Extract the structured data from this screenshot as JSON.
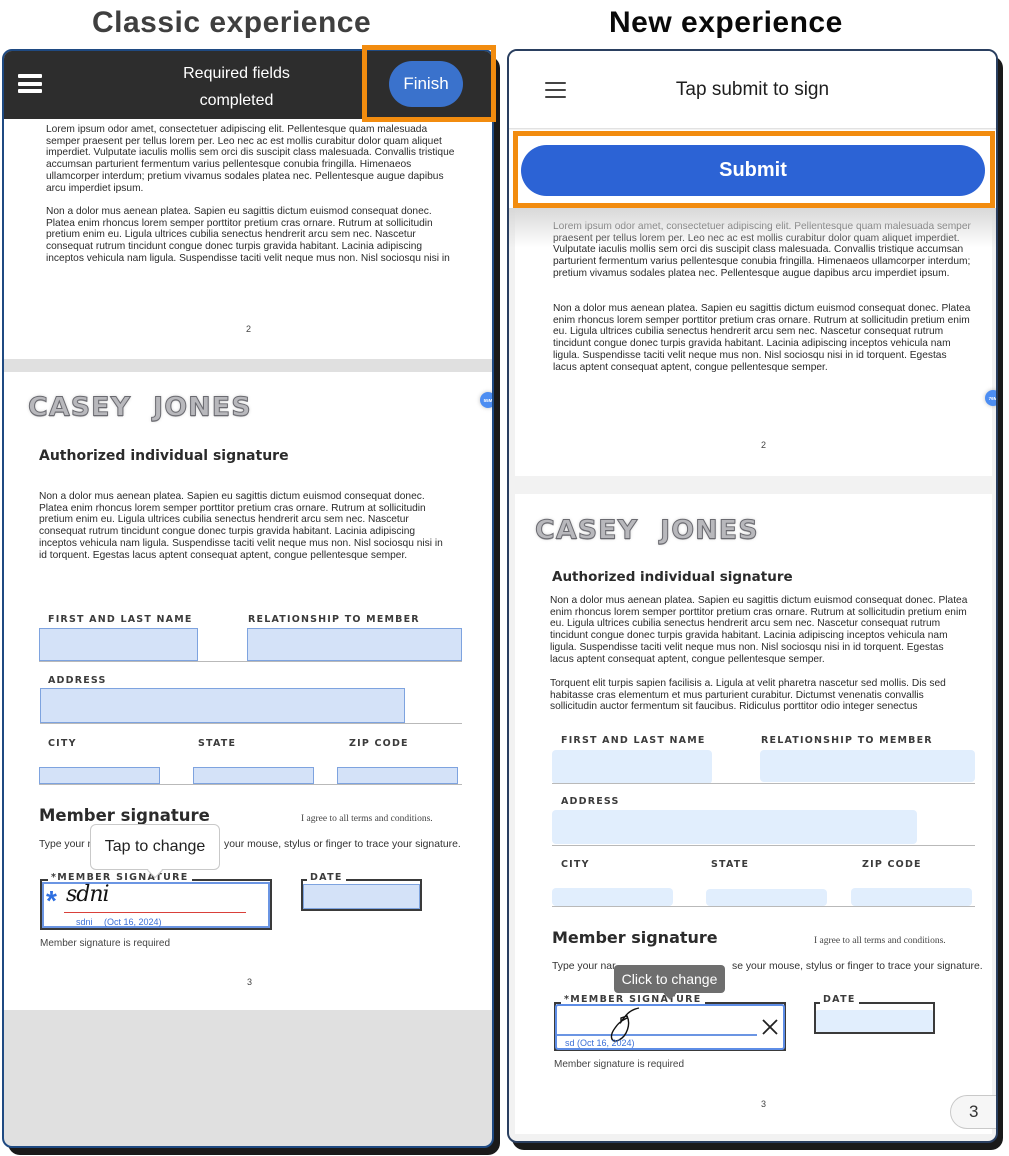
{
  "captions": {
    "classic": "Classic experience",
    "new": "New experience"
  },
  "colors": {
    "highlight_box": "#f28c0f",
    "classic_finish_button": "#3a72cc",
    "new_submit_button": "#2c63d5",
    "field_fill": "#d4e2f8"
  },
  "classic": {
    "header": {
      "menu_icon": "hamburger-menu-icon",
      "title_line1": "Required fields",
      "title_line2": "completed",
      "finish_label": "Finish"
    },
    "page2": {
      "para1": "Lorem ipsum odor amet, consectetuer adipiscing elit. Pellentesque quam malesuada semper praesent per tellus lorem per. Leo nec ac est mollis curabitur dolor quam aliquet imperdiet. Vulputate iaculis mollis sem orci dis suscipit class malesuada. Convallis tristique accumsan parturient fermentum varius pellentesque conubia fringilla. Himenaeos ullamcorper interdum; pretium vivamus sodales platea nec. Pellentesque augue dapibus arcu imperdiet ipsum.",
      "para2": "Non a dolor mus aenean platea. Sapien eu sagittis dictum euismod consequat donec. Platea enim rhoncus lorem semper porttitor pretium cras ornare. Rutrum at sollicitudin pretium enim eu. Ligula ultrices cubilia senectus hendrerit arcu sem nec. Nascetur consequat rutrum tincidunt congue donec turpis gravida habitant. Lacinia adipiscing inceptos vehicula nam ligula. Suspendisse taciti velit neque mus non. Nisl sociosqu nisi in",
      "page_number": "2"
    },
    "page3": {
      "logo_first": "CASEY",
      "logo_last": "JONES",
      "badge": "55M",
      "section_title": "Authorized individual signature",
      "para": "Non a dolor mus aenean platea. Sapien eu sagittis dictum euismod consequat donec. Platea enim rhoncus lorem semper porttitor pretium cras ornare. Rutrum at sollicitudin pretium enim eu. Ligula ultrices cubilia senectus hendrerit arcu sem nec. Nascetur consequat rutrum tincidunt congue donec turpis gravida habitant. Lacinia adipiscing inceptos vehicula nam ligula. Suspendisse taciti velit neque mus non. Nisl sociosqu nisi in id torquent. Egestas lacus aptent consequat aptent, congue pellentesque semper.",
      "labels": {
        "name": "FIRST AND LAST NAME",
        "relationship": "RELATIONSHIP TO MEMBER",
        "address": "ADDRESS",
        "city": "CITY",
        "state": "STATE",
        "zip": "ZIP CODE"
      },
      "values": {
        "name": "",
        "relationship": "",
        "address": "",
        "city": "",
        "state": "",
        "zip": "",
        "date": ""
      },
      "member_signature_title": "Member signature",
      "agree_text": "I agree to all terms and conditions.",
      "help_text": "Type your name, or use your mouse, stylus or finger to trace your signature.",
      "help_text_visible_left": "Type your n",
      "help_text_visible_right": "your mouse, stylus or finger to trace your signature.",
      "tooltip": "Tap to change",
      "signature_label": "*MEMBER SIGNATURE",
      "signature_value": "sdni",
      "signature_caption_name": "sdni",
      "signature_caption_date": "(Oct 16, 2024)",
      "required_marker": "*",
      "date_label": "DATE",
      "required_text": "Member signature is required",
      "page_number": "3"
    }
  },
  "new": {
    "header": {
      "menu_icon": "hamburger-menu-icon",
      "title": "Tap submit to sign",
      "submit_label": "Submit"
    },
    "page2": {
      "para1": "Lorem ipsum odor amet, consectetuer adipiscing elit. Pellentesque quam malesuada semper praesent per tellus lorem per. Leo nec ac est mollis curabitur dolor quam aliquet imperdiet. Vulputate iaculis mollis sem orci dis suscipit class malesuada. Convallis tristique accumsan parturient fermentum varius pellentesque conubia fringilla. Himenaeos ullamcorper interdum; pretium vivamus sodales platea nec. Pellentesque augue dapibus arcu imperdiet ipsum.",
      "para2": "Non a dolor mus aenean platea. Sapien eu sagittis dictum euismod consequat donec. Platea enim rhoncus lorem semper porttitor pretium cras ornare. Rutrum at sollicitudin pretium enim eu. Ligula ultrices cubilia senectus hendrerit arcu sem nec. Nascetur consequat rutrum tincidunt congue donec turpis gravida habitant. Lacinia adipiscing inceptos vehicula nam ligula. Suspendisse taciti velit neque mus non. Nisl sociosqu nisi in id torquent. Egestas lacus aptent consequat aptent, congue pellentesque semper.",
      "page_number": "2"
    },
    "page3": {
      "logo_first": "CASEY",
      "logo_last": "JONES",
      "badge": "76M",
      "section_title": "Authorized individual signature",
      "para1": "Non a dolor mus aenean platea. Sapien eu sagittis dictum euismod consequat donec. Platea enim rhoncus lorem semper porttitor pretium cras ornare. Rutrum at sollicitudin pretium enim eu. Ligula ultrices cubilia senectus hendrerit arcu sem nec. Nascetur consequat rutrum tincidunt congue donec turpis gravida habitant. Lacinia adipiscing inceptos vehicula nam ligula. Suspendisse taciti velit neque mus non. Nisl sociosqu nisi in id torquent. Egestas lacus aptent consequat aptent, congue pellentesque semper.",
      "para2": "Torquent elit turpis sapien facilisis a. Ligula at velit pharetra nascetur sed mollis. Dis sed habitasse cras elementum et mus parturient curabitur. Dictumst venenatis convallis sollicitudin auctor fermentum sit faucibus. Ridiculus porttitor odio integer senectus",
      "labels": {
        "name": "FIRST AND LAST NAME",
        "relationship": "RELATIONSHIP TO MEMBER",
        "address": "ADDRESS",
        "city": "CITY",
        "state": "STATE",
        "zip": "ZIP CODE"
      },
      "values": {
        "name": "",
        "relationship": "",
        "address": "",
        "city": "",
        "state": "",
        "zip": "",
        "date": ""
      },
      "member_signature_title": "Member signature",
      "agree_text": "I agree to all terms and conditions.",
      "help_text_visible_left": "Type your nar",
      "help_text_visible_right": "se your mouse, stylus or finger to trace your signature.",
      "tooltip": "Click to change",
      "signature_label": "*MEMBER SIGNATURE",
      "signature_caption": "sd (Oct 16, 2024)",
      "clear_icon": "close-icon",
      "date_label": "DATE",
      "required_text": "Member signature is required",
      "page_number": "3",
      "current_page_indicator": "3"
    }
  }
}
